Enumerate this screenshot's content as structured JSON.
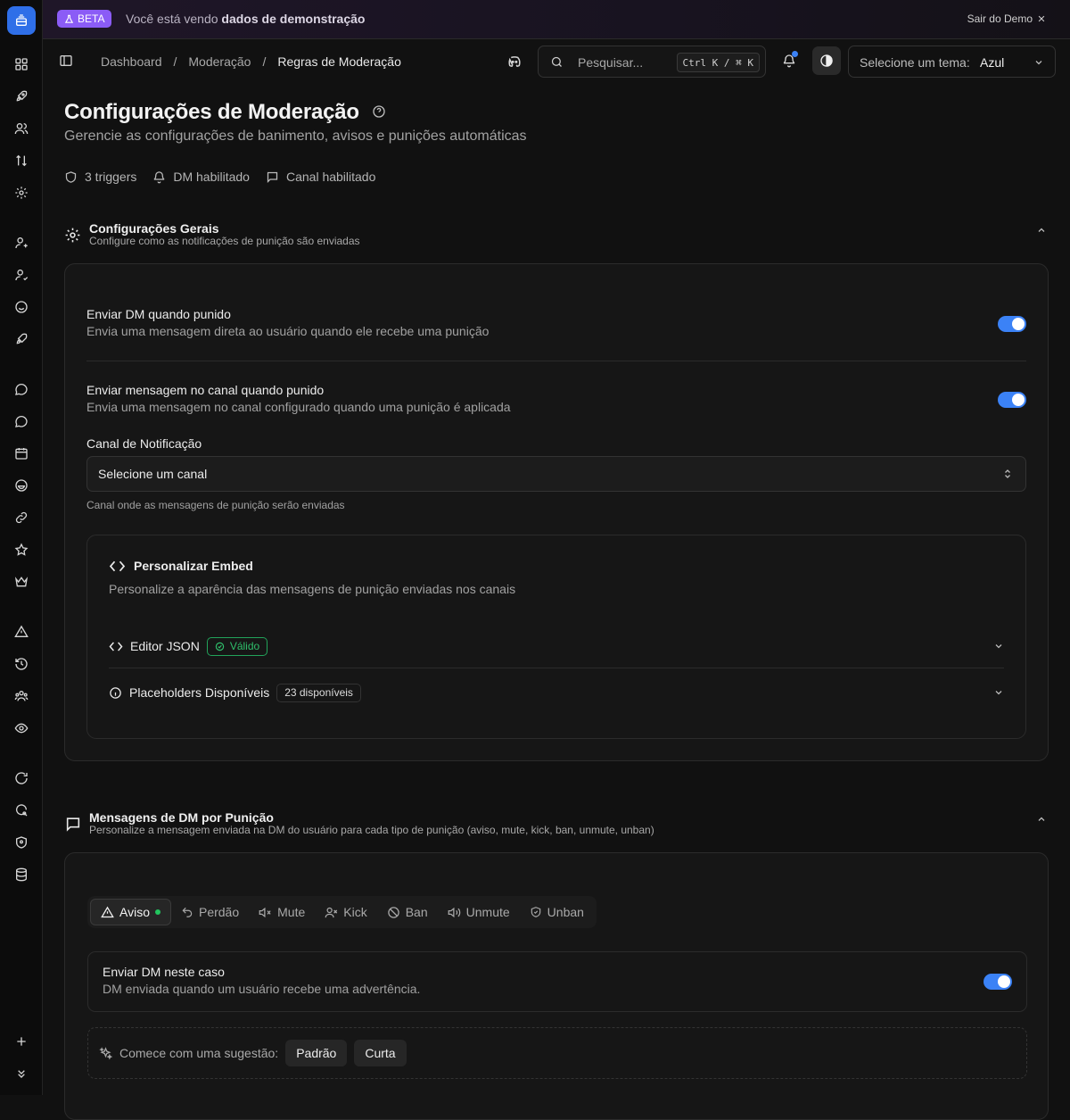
{
  "banner": {
    "badge": "BETA",
    "message_prefix": "Você está vendo ",
    "message_bold": "dados de demonstração",
    "exit_label": "Sair do Demo"
  },
  "breadcrumb": [
    "Dashboard",
    "Moderação",
    "Regras de Moderação"
  ],
  "search": {
    "placeholder": "Pesquisar...",
    "shortcut": "Ctrl K / ⌘ K"
  },
  "theme": {
    "label": "Selecione um tema:",
    "value": "Azul"
  },
  "page": {
    "title": "Configurações de Moderação",
    "subtitle": "Gerencie as configurações de banimento, avisos e punições automáticas",
    "stats": [
      "3 triggers",
      "DM habilitado",
      "Canal habilitado"
    ]
  },
  "general": {
    "title": "Configurações Gerais",
    "description": "Configure como as notificações de punição são enviadas",
    "dm_title": "Enviar DM quando punido",
    "dm_desc": "Envia uma mensagem direta ao usuário quando ele recebe uma punição",
    "dm_enabled": true,
    "channel_title": "Enviar mensagem no canal quando punido",
    "channel_desc": "Envia uma mensagem no canal configurado quando uma punição é aplicada",
    "channel_enabled": true,
    "notif_label": "Canal de Notificação",
    "notif_value": "Selecione um canal",
    "notif_help": "Canal onde as mensagens de punição serão enviadas",
    "embed_title": "Personalizar Embed",
    "embed_desc": "Personalize a aparência das mensagens de punição enviadas nos canais",
    "json_title": "Editor JSON",
    "json_badge": "Válido",
    "placeholders_title": "Placeholders Disponíveis",
    "placeholders_badge": "23 disponíveis"
  },
  "dm": {
    "title": "Mensagens de DM por Punição",
    "description": "Personalize a mensagem enviada na DM do usuário para cada tipo de punição (aviso, mute, kick, ban, unmute, unban)",
    "tabs": [
      "Aviso",
      "Perdão",
      "Mute",
      "Kick",
      "Ban",
      "Unmute",
      "Unban"
    ],
    "active_tab": "Aviso",
    "send_title": "Enviar DM neste caso",
    "send_desc": "DM enviada quando um usuário recebe uma advertência.",
    "send_enabled": true,
    "suggest_label": "Comece com uma sugestão:",
    "suggestions": [
      "Padrão",
      "Curta"
    ]
  },
  "colors": {
    "accent": "#3b82f6",
    "beta": "#8b5cf6",
    "valid": "#22c55e"
  }
}
